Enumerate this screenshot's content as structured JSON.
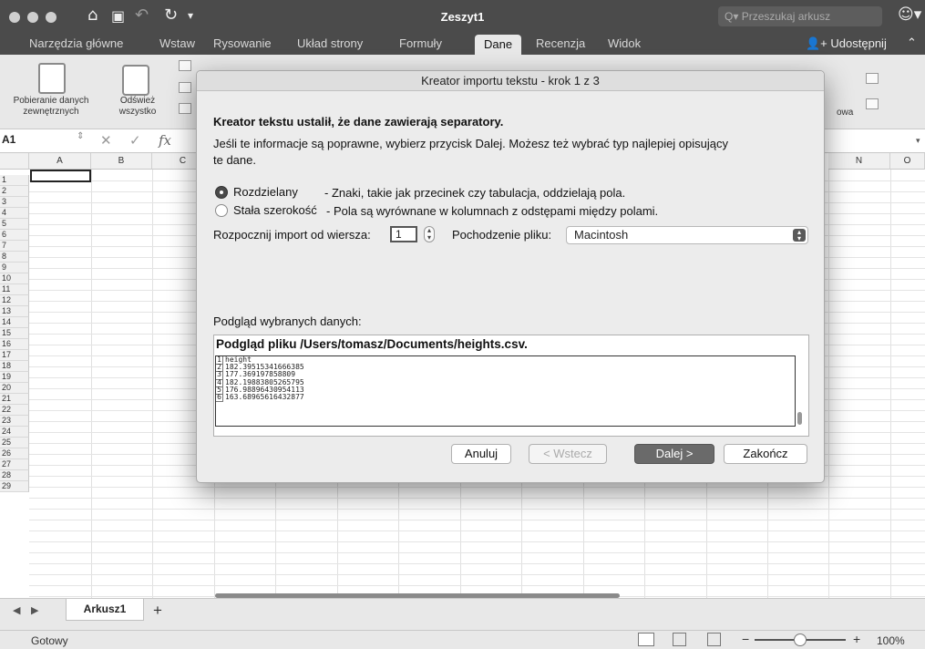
{
  "window": {
    "title": "Zeszyt1",
    "search_placeholder": "Przeszukaj arkusz",
    "search_icon": "Q▾",
    "user_icon": "☺▾"
  },
  "menu_tabs": [
    "Narzędzia główne",
    "Wstaw",
    "Rysowanie",
    "Układ strony",
    "Formuły",
    "Dane",
    "Recenzja",
    "Widok"
  ],
  "active_tab": "Dane",
  "share_label": "Udostępnij",
  "ribbon": {
    "get_data_label": "Pobieranie danych zewnętrznych",
    "refresh_label": "Odśwież wszystko",
    "right_fragment": "owa"
  },
  "formula_bar": {
    "cell_ref": "A1",
    "fx": "fx"
  },
  "columns": [
    "A",
    "B",
    "C",
    "N",
    "O"
  ],
  "rows": [
    "1",
    "2",
    "3",
    "4",
    "5",
    "6",
    "7",
    "8",
    "9",
    "10",
    "11",
    "12",
    "13",
    "14",
    "15",
    "16",
    "17",
    "18",
    "19",
    "20",
    "21",
    "22",
    "23",
    "24",
    "25",
    "26",
    "27",
    "28",
    "29"
  ],
  "sheet_tabs": [
    "Arkusz1"
  ],
  "add_sheet": "+",
  "status": {
    "text": "Gotowy",
    "zoom": "100%",
    "zoom_minus": "−",
    "zoom_plus": "+"
  },
  "dialog": {
    "title": "Kreator importu tekstu - krok 1 z 3",
    "heading": "Kreator tekstu ustalił, że dane zawierają separatory.",
    "info_line1": "Jeśli te informacje są poprawne, wybierz przycisk Dalej. Możesz też wybrać typ najlepiej opisujący",
    "info_line2": "te dane.",
    "option_delimited": "Rozdzielany",
    "option_delimited_desc": "- Znaki, takie jak przecinek czy tabulacja, oddzielają pola.",
    "option_fixed": "Stała szerokość",
    "option_fixed_desc": "- Pola są wyrównane w kolumnach z odstępami między polami.",
    "start_row_label": "Rozpocznij import od wiersza:",
    "start_row_value": "1",
    "origin_label": "Pochodzenie pliku:",
    "origin_value": "Macintosh",
    "preview_label": "Podgląd wybranych danych:",
    "preview_title": "Podgląd pliku /Users/tomasz/Documents/heights.csv.",
    "preview_rows": [
      {
        "n": "1",
        "v": "height"
      },
      {
        "n": "2",
        "v": "182.39515341666385"
      },
      {
        "n": "3",
        "v": "177.369197858809"
      },
      {
        "n": "4",
        "v": "182.19883805265795"
      },
      {
        "n": "5",
        "v": "176.98896430954113"
      },
      {
        "n": "6",
        "v": "163.68965616432877"
      }
    ],
    "buttons": {
      "cancel": "Anuluj",
      "back": "< Wstecz",
      "next": "Dalej >",
      "finish": "Zakończ"
    }
  }
}
